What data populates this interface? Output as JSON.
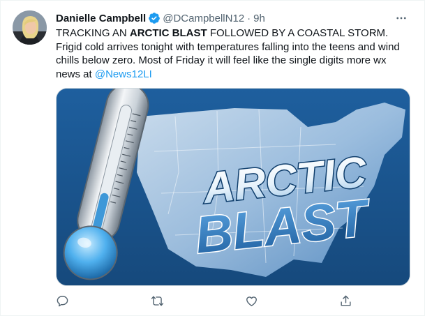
{
  "tweet": {
    "author_name": "Danielle Campbell",
    "handle": "@DCampbellN12",
    "separator": "·",
    "time": "9h",
    "more_icon": "more-dots-icon",
    "verified_icon": "verified-badge-icon",
    "text": {
      "line1_pre": "TRACKING AN ",
      "line1_bold": "ARCTIC BLAST",
      "line1_post": " FOLLOWED BY A COASTAL STORM.",
      "line2": "Frigid cold arrives tonight with temperatures falling into the teens and wind",
      "line3": "chills below zero. Most of Friday it will feel like the single digits more wx",
      "line4_pre": "news at ",
      "line4_mention": "@News12LI"
    },
    "media": {
      "word1": "ARCTIC",
      "word2": "BLAST"
    },
    "actions": {
      "reply_icon": "reply-icon",
      "retweet_icon": "retweet-icon",
      "like_icon": "like-heart-icon",
      "share_icon": "share-icon"
    }
  },
  "colors": {
    "accent": "#1d9bf0",
    "secondary_text": "#536471",
    "primary_text": "#0f1419"
  }
}
